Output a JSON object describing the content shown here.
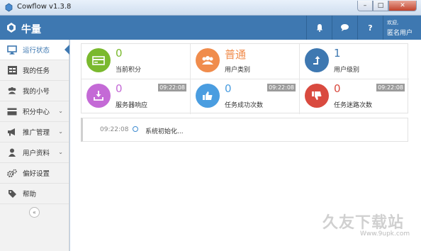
{
  "window": {
    "title": "Cowflow v1.3.8",
    "min": "–",
    "max": "□",
    "close": "✕"
  },
  "header": {
    "app_name": "牛量",
    "welcome": "欢迎,",
    "username": "匿名用户",
    "icons": [
      "bell-icon",
      "chat-icon",
      "help-icon"
    ],
    "help_label": "?"
  },
  "colors": {
    "brand": "#3e78b1",
    "green": "#7ab92e",
    "orange": "#f08c4c",
    "blue": "#3e78b1",
    "purple": "#c46ad6",
    "lightblue": "#4a9de0",
    "red": "#d94a3f"
  },
  "sidebar": {
    "items": [
      {
        "label": "运行状态",
        "icon": "monitor-icon",
        "active": true
      },
      {
        "label": "我的任务",
        "icon": "task-list-icon"
      },
      {
        "label": "我的小号",
        "icon": "users-icon"
      },
      {
        "label": "积分中心",
        "icon": "card-icon",
        "expand": "⌄"
      },
      {
        "label": "推广管理",
        "icon": "megaphone-icon",
        "expand": "⌄"
      },
      {
        "label": "用户资料",
        "icon": "user-icon",
        "expand": "⌄"
      },
      {
        "label": "偏好设置",
        "icon": "gears-icon"
      },
      {
        "label": "帮助",
        "icon": "tag-icon"
      }
    ],
    "collapse_label": "«"
  },
  "stats": [
    {
      "value": "0",
      "label": "当前积分",
      "icon": "credit-card-icon",
      "color": "#7ab92e",
      "value_color": "#7ab92e",
      "time": ""
    },
    {
      "value": "普通",
      "label": "用户类别",
      "icon": "user-group-icon",
      "color": "#f08c4c",
      "value_color": "#f08c4c",
      "time": ""
    },
    {
      "value": "1",
      "label": "用户级别",
      "icon": "level-up-icon",
      "color": "#3e78b1",
      "value_color": "#3e78b1",
      "time": ""
    },
    {
      "value": "0",
      "label": "服务器响应",
      "icon": "download-tray-icon",
      "color": "#c46ad6",
      "value_color": "#c46ad6",
      "time": "09:22:08"
    },
    {
      "value": "0",
      "label": "任务成功次数",
      "icon": "thumbs-up-icon",
      "color": "#4a9de0",
      "value_color": "#4a9de0",
      "time": "09:22:08"
    },
    {
      "value": "0",
      "label": "任务迷路次数",
      "icon": "thumbs-down-icon",
      "color": "#d94a3f",
      "value_color": "#d94a3f",
      "time": "09:22:08"
    }
  ],
  "log": {
    "time": "09:22:08",
    "text": "系统初始化..."
  },
  "watermark": {
    "main": "久友下载站",
    "sub": "Www.9upk.com"
  }
}
